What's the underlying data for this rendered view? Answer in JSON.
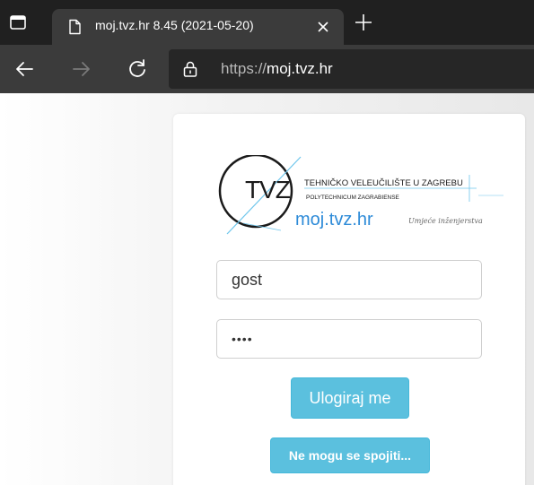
{
  "browser": {
    "tab_title": "moj.tvz.hr 8.45 (2021-05-20)",
    "url_scheme": "https://",
    "url_host": "moj.tvz.hr"
  },
  "logo": {
    "acronym": "TVZ",
    "line1": "TEHNIČKO VELEUČILIŠTE U ZAGREBU",
    "line2": "POLYTECHNICUM ZAGRABIENSE",
    "site": "moj.tvz.hr",
    "tagline": "Umjeće inženjerstva"
  },
  "login": {
    "username_value": "gost",
    "password_value": "••••",
    "login_button": "Ulogiraj me",
    "cannot_connect_button": "Ne mogu se spojiti..."
  },
  "colors": {
    "button_bg": "#5bc0de",
    "site_blue": "#2e8bd8",
    "tab_bar": "#202020",
    "toolbar": "#3b3b3b"
  },
  "icons": [
    "window-icon",
    "page-icon",
    "close-icon",
    "plus-icon",
    "back-arrow-icon",
    "forward-arrow-icon",
    "reload-icon",
    "lock-icon"
  ]
}
